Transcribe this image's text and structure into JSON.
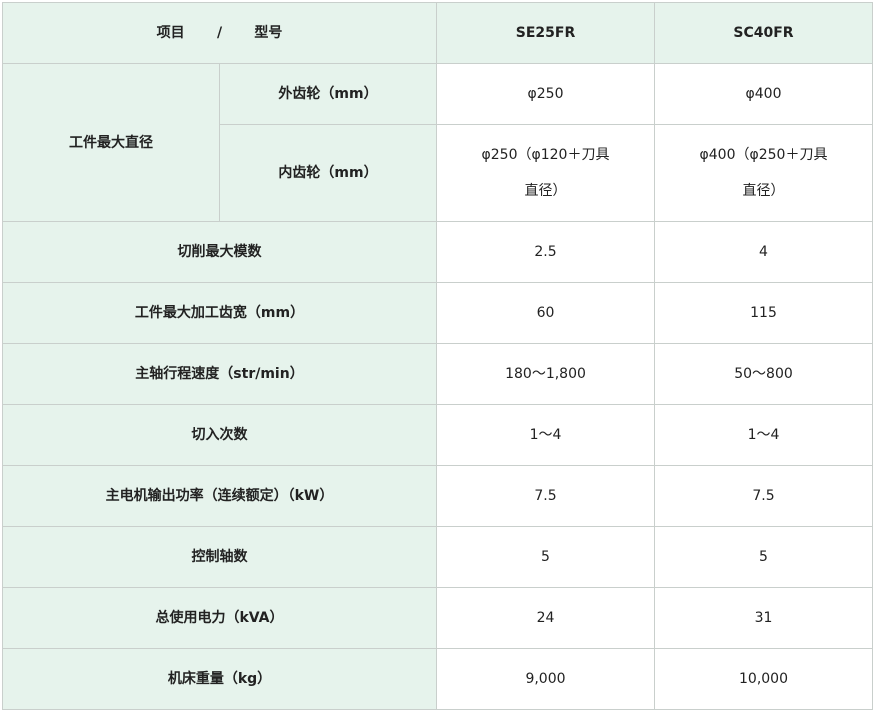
{
  "header": {
    "item": "项目",
    "separator": "/",
    "model": "型号",
    "col1": "SE25FR",
    "col2": "SC40FR"
  },
  "rows": [
    {
      "group": "工件最大直径",
      "label": "外齿轮（mm）",
      "v1": "φ250",
      "v2": "φ400"
    },
    {
      "label": "内齿轮（mm）",
      "v1_line1": "φ250（φ120＋刀具",
      "v1_line2": "直径）",
      "v2_line1": "φ400（φ250＋刀具",
      "v2_line2": "直径）"
    },
    {
      "label": "切削最大模数",
      "v1": "2.5",
      "v2": "4"
    },
    {
      "label": "工件最大加工齿宽（mm）",
      "v1": "60",
      "v2": "115"
    },
    {
      "label": "主轴行程速度（str/min）",
      "v1": "180～1,800",
      "v2": "50～800"
    },
    {
      "label": "切入次数",
      "v1": "1～4",
      "v2": "1～4"
    },
    {
      "label": "主电机输出功率（连续额定）（kW）",
      "v1": "7.5",
      "v2": "7.5"
    },
    {
      "label": "控制轴数",
      "v1": "5",
      "v2": "5"
    },
    {
      "label": "总使用电力（kVA）",
      "v1": "24",
      "v2": "31"
    },
    {
      "label": "机床重量（kg）",
      "v1": "9,000",
      "v2": "10,000"
    }
  ]
}
